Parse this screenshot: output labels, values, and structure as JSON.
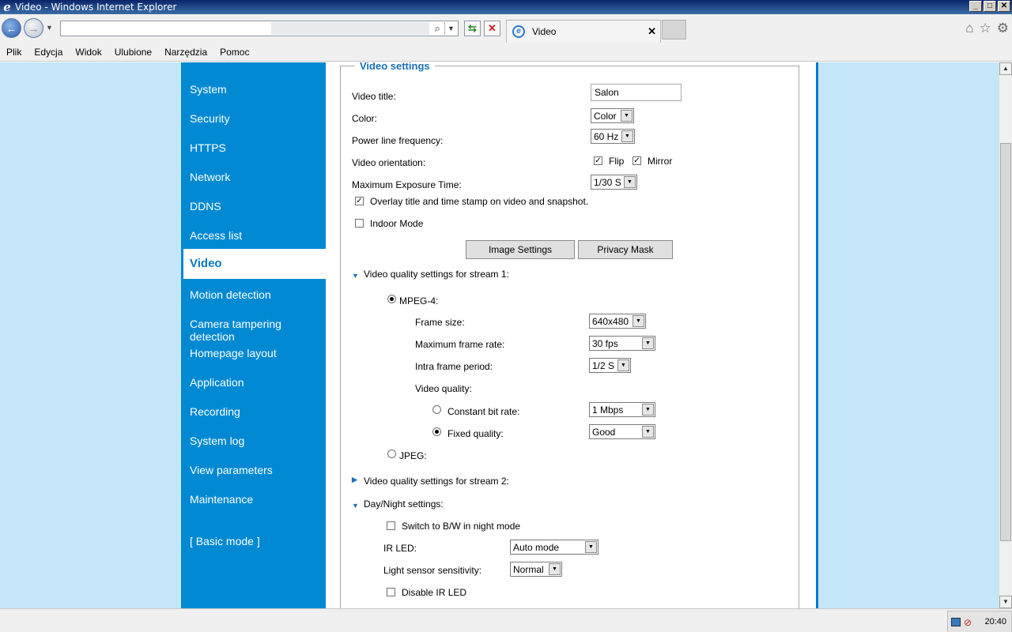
{
  "window": {
    "title": "Video - Windows Internet Explorer"
  },
  "browser": {
    "address_value": "",
    "tab_label": "Video",
    "menu": [
      "Plik",
      "Edycja",
      "Widok",
      "Ulubione",
      "Narzędzia",
      "Pomoc"
    ]
  },
  "sidebar": {
    "items": [
      "System",
      "Security",
      "HTTPS",
      "Network",
      "DDNS",
      "Access list",
      "Video",
      "Motion detection",
      "Camera tampering detection",
      "Homepage layout",
      "Application",
      "Recording",
      "System log",
      "View parameters",
      "Maintenance",
      "[ Basic mode ]"
    ],
    "active": "Video"
  },
  "video_settings": {
    "legend": "Video settings",
    "video_title_label": "Video title:",
    "video_title_value": "Salon",
    "color_label": "Color:",
    "color_value": "Color",
    "power_label": "Power line frequency:",
    "power_value": "60 Hz",
    "orientation_label": "Video orientation:",
    "flip_label": "Flip",
    "mirror_label": "Mirror",
    "exposure_label": "Maximum Exposure Time:",
    "exposure_value": "1/30 S",
    "overlay_label": "Overlay title and time stamp on video and snapshot.",
    "indoor_label": "Indoor Mode",
    "image_settings_btn": "Image Settings",
    "privacy_mask_btn": "Privacy Mask",
    "stream1_label": "Video quality settings for stream 1:",
    "mpeg4_label": "MPEG-4:",
    "frame_size_label": "Frame size:",
    "frame_size_value": "640x480",
    "max_frame_rate_label": "Maximum frame rate:",
    "max_frame_rate_value": "30 fps",
    "intra_label": "Intra frame period:",
    "intra_value": "1/2 S",
    "quality_label": "Video quality:",
    "cbr_label": "Constant bit rate:",
    "cbr_value": "1 Mbps",
    "fixed_label": "Fixed quality:",
    "fixed_value": "Good",
    "jpeg_label": "JPEG:",
    "stream2_label": "Video quality settings for stream 2:",
    "daynight_label": "Day/Night settings:",
    "bw_label": "Switch to B/W in night mode",
    "ir_led_label": "IR LED:",
    "ir_led_value": "Auto mode",
    "light_sensor_label": "Light sensor sensitivity:",
    "light_sensor_value": "Normal",
    "disable_ir_label": "Disable IR LED"
  },
  "tray": {
    "time": "20:40"
  }
}
